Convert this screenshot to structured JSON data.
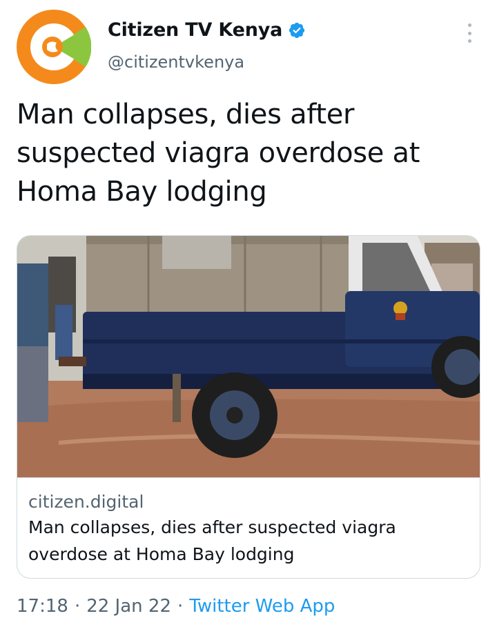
{
  "account": {
    "name": "Citizen TV Kenya",
    "handle": "@citizentvkenya",
    "avatar_icon": "citizen-tv-logo",
    "verified": true,
    "colors": {
      "orange": "#f48a1c",
      "green": "#8cc63f",
      "verified_blue": "#1d9bf0"
    }
  },
  "tweet": {
    "text": "Man collapses, dies after suspected viagra overdose at Homa Bay lodging"
  },
  "card": {
    "domain": "citizen.digital",
    "title": "Man collapses, dies after suspected viagra overdose at Homa Bay lodging",
    "image_alt_icon": "police-truck-photo"
  },
  "meta": {
    "time": "17:18",
    "separator": "·",
    "date": "22 Jan 22",
    "source": "Twitter Web App"
  },
  "more_icon": "more-vertical-icon"
}
